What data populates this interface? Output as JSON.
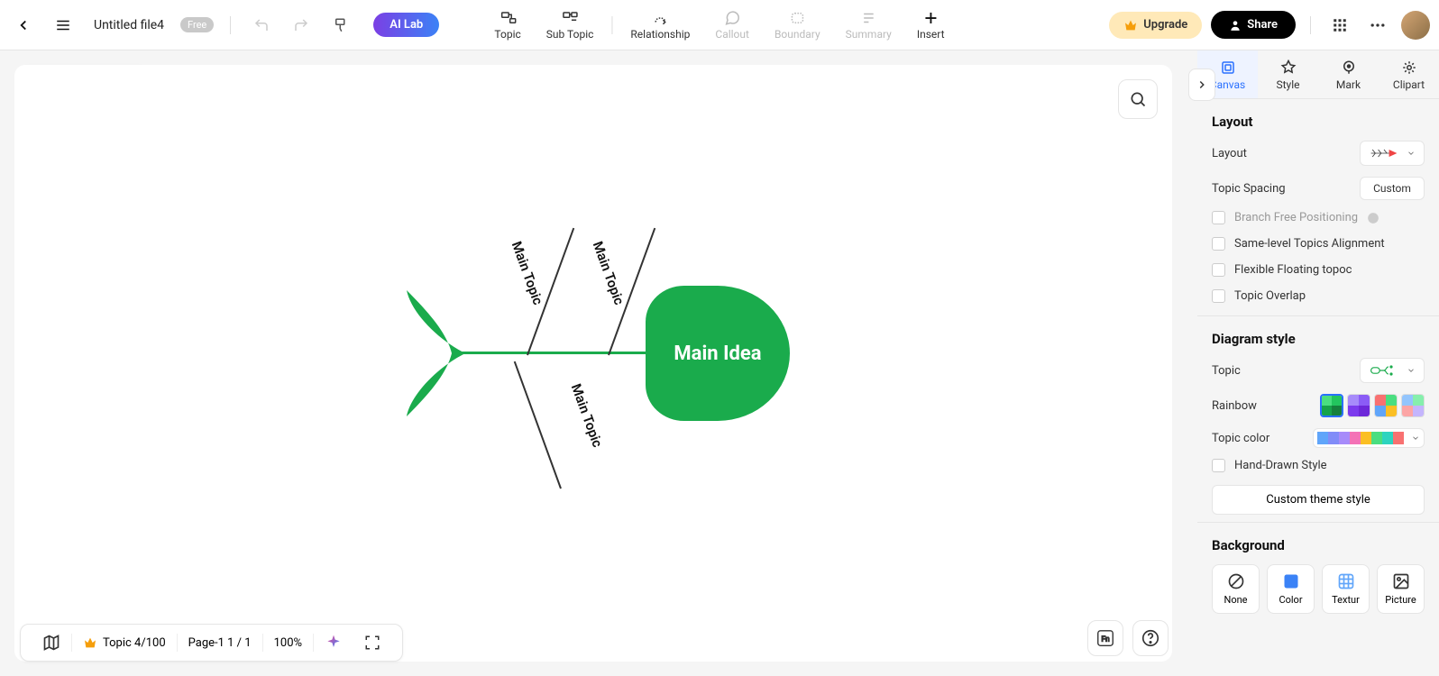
{
  "header": {
    "filename": "Untitled file4",
    "free_badge": "Free",
    "ai_lab": "AI Lab"
  },
  "toolbar_center": {
    "topic": "Topic",
    "subtopic": "Sub Topic",
    "relationship": "Relationship",
    "callout": "Callout",
    "boundary": "Boundary",
    "summary": "Summary",
    "insert": "Insert"
  },
  "toolbar_right": {
    "upgrade": "Upgrade",
    "share": "Share"
  },
  "diagram": {
    "main_idea": "Main Idea",
    "topic1": "Main Topic",
    "topic2": "Main Topic",
    "topic3": "Main Topic"
  },
  "rightpanel": {
    "tabs": {
      "canvas": "Canvas",
      "style": "Style",
      "mark": "Mark",
      "clipart": "Clipart"
    },
    "layout": {
      "title": "Layout",
      "layout_label": "Layout",
      "spacing_label": "Topic Spacing",
      "spacing_value": "Custom",
      "branch_free": "Branch Free Positioning",
      "same_level": "Same-level Topics Alignment",
      "flexible_float": "Flexible Floating topoc",
      "overlap": "Topic Overlap"
    },
    "diagram_style": {
      "title": "Diagram style",
      "topic": "Topic",
      "rainbow": "Rainbow",
      "topic_color": "Topic color",
      "hand_drawn": "Hand-Drawn Style",
      "custom_theme": "Custom theme style"
    },
    "background": {
      "title": "Background",
      "none": "None",
      "color": "Color",
      "textur": "Textur",
      "picture": "Picture"
    }
  },
  "bottombar": {
    "topic_count": "Topic 4/100",
    "page": "Page-1  1 / 1",
    "zoom": "100%"
  }
}
